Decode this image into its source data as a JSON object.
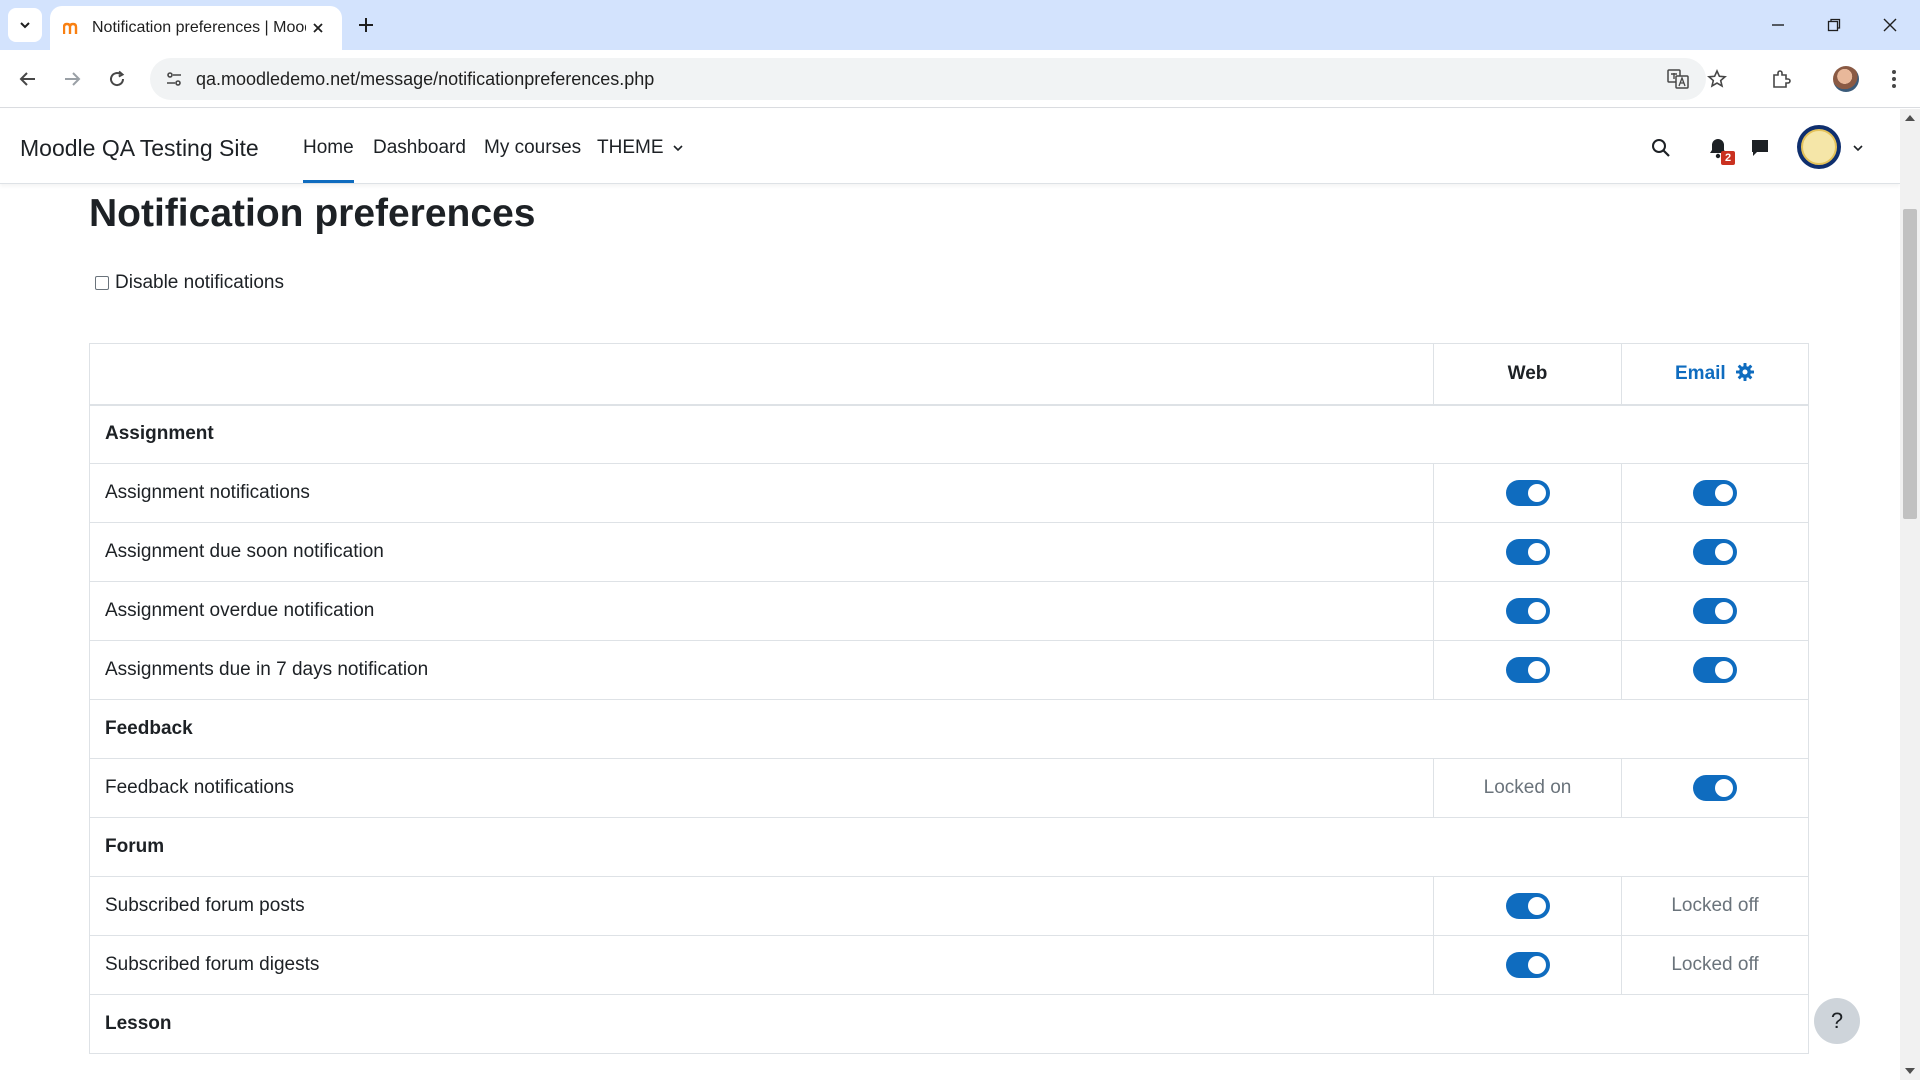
{
  "browser": {
    "tab_title": "Notification preferences | Mood",
    "url": "qa.moodledemo.net/message/notificationpreferences.php"
  },
  "navbar": {
    "site_name": "Moodle QA Testing Site",
    "links": [
      "Home",
      "Dashboard",
      "My courses",
      "THEME"
    ],
    "notification_count": "2"
  },
  "page": {
    "title": "Notification preferences",
    "disable_label": "Disable notifications",
    "col_web": "Web",
    "col_email": "Email",
    "help": "?"
  },
  "rows": [
    {
      "type": "group",
      "label": "Assignment"
    },
    {
      "type": "item",
      "label": "Assignment notifications",
      "web": "on",
      "email": "on"
    },
    {
      "type": "item",
      "label": "Assignment due soon notification",
      "web": "on",
      "email": "on"
    },
    {
      "type": "item",
      "label": "Assignment overdue notification",
      "web": "on",
      "email": "on"
    },
    {
      "type": "item",
      "label": "Assignments due in 7 days notification",
      "web": "on",
      "email": "on"
    },
    {
      "type": "group",
      "label": "Feedback"
    },
    {
      "type": "item",
      "label": "Feedback notifications",
      "web": "Locked on",
      "email": "on"
    },
    {
      "type": "group",
      "label": "Forum"
    },
    {
      "type": "item",
      "label": "Subscribed forum posts",
      "web": "on",
      "email": "Locked off"
    },
    {
      "type": "item",
      "label": "Subscribed forum digests",
      "web": "on",
      "email": "Locked off"
    },
    {
      "type": "group",
      "label": "Lesson"
    }
  ],
  "colors": {
    "accent": "#0f6cbf",
    "tabstrip": "#d3e3fd"
  }
}
